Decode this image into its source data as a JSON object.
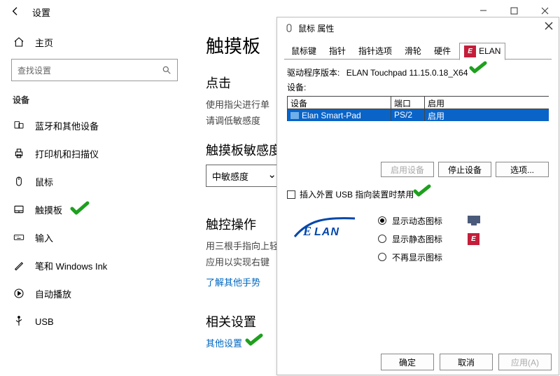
{
  "settings": {
    "title": "设置",
    "home": "主页",
    "search_placeholder": "查找设置",
    "devices_heading": "设备",
    "nav": [
      {
        "label": "蓝牙和其他设备"
      },
      {
        "label": "打印机和扫描仪"
      },
      {
        "label": "鼠标"
      },
      {
        "label": "触摸板"
      },
      {
        "label": "输入"
      },
      {
        "label": "笔和 Windows Ink"
      },
      {
        "label": "自动播放"
      },
      {
        "label": "USB"
      }
    ]
  },
  "content": {
    "title": "触摸板",
    "click_heading": "点击",
    "click_line1": "使用指尖进行单",
    "click_line2": "请调低敏感度",
    "sensitivity_heading": "触摸板敏感度",
    "sensitivity_value": "中敏感度",
    "gesture_heading": "触控操作",
    "gesture_line1": "用三根手指向上轻",
    "gesture_line2": "应用以实现右键",
    "gesture_link": "了解其他手势",
    "related_heading": "相关设置",
    "related_link": "其他设置"
  },
  "dialog": {
    "title": "鼠标 属性",
    "tabs": [
      "鼠标键",
      "指针",
      "指针选项",
      "滑轮",
      "硬件"
    ],
    "elan_tab": "ELAN",
    "driver_version_label": "驱动程序版本:",
    "driver_version": "ELAN Touchpad 11.15.0.18_X64",
    "device_label": "设备:",
    "table_head": [
      "设备",
      "端口",
      "启用"
    ],
    "table_row": [
      "Elan Smart-Pad",
      "PS/2",
      "启用"
    ],
    "btn_enable": "启用设备",
    "btn_stop": "停止设备",
    "btn_options": "选项...",
    "usb_checkbox": "插入外置 USB 指向装置时禁用",
    "radio1": "显示动态图标",
    "radio2": "显示静态图标",
    "radio3": "不再显示图标",
    "ok": "确定",
    "cancel": "取消",
    "apply": "应用(A)"
  }
}
